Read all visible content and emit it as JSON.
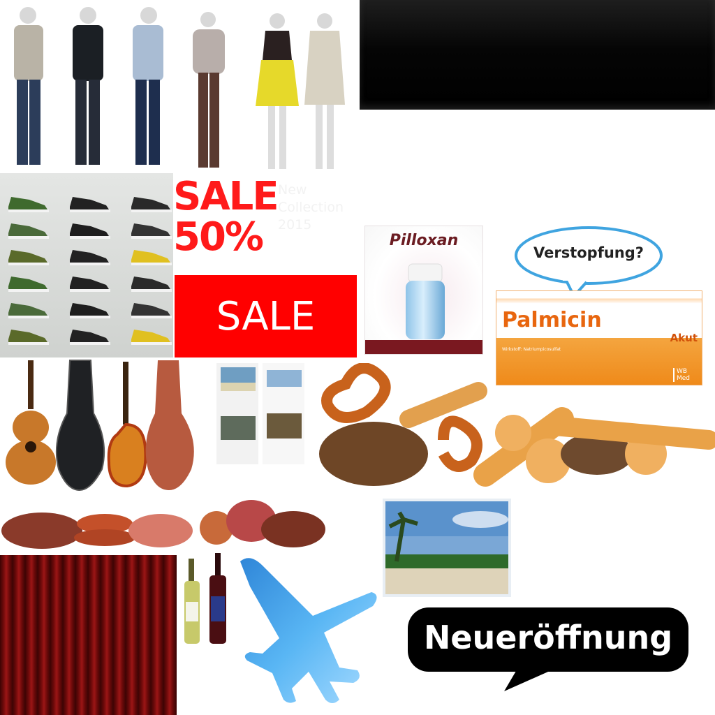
{
  "sale_block": {
    "sale_word": "SALE",
    "sale_percent": "50%",
    "collection_lines": [
      "New",
      "Collection",
      "2015"
    ]
  },
  "sale_banner": {
    "label": "SALE"
  },
  "pilloxan": {
    "name": "Pilloxan",
    "stripe_color": "#7a1820"
  },
  "speech_bubble": {
    "text": "Verstopfung?"
  },
  "palmicin": {
    "name": "Palmicin",
    "variant": "Akut",
    "small_print": "Wirkstoff: Natriumpicosulfat",
    "logo_lines": [
      "WB",
      "Med"
    ]
  },
  "announcement": {
    "text": "Neueröffnung"
  },
  "colors": {
    "sale_red": "#ff1a1a",
    "orange": "#ef8a1a",
    "bubble_outline": "#3fa4e0",
    "airplane_blue": "#4fb3f0"
  },
  "icons": {
    "airplane": "airplane-icon",
    "speech_bubble": "speech-bubble-icon"
  }
}
